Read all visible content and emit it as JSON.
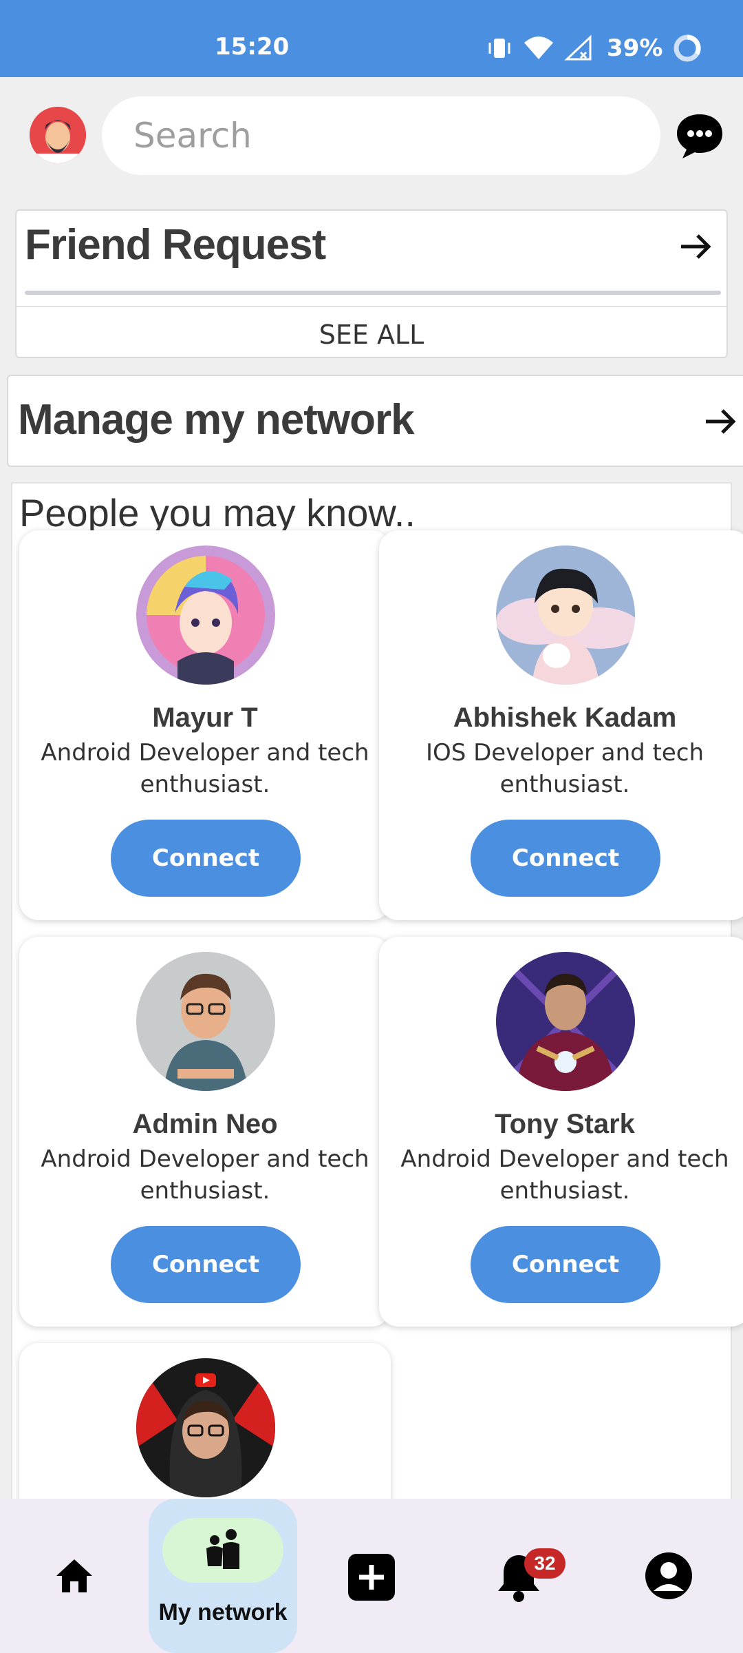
{
  "status_bar": {
    "time": "15:20",
    "battery": "39%",
    "icons": [
      "vibrate-icon",
      "wifi-icon",
      "signal-icon",
      "battery-ring-icon"
    ]
  },
  "top_bar": {
    "search_placeholder": "Search",
    "avatar_icon": "user-avatar",
    "chat_icon": "chat-bubble-icon"
  },
  "friend_request": {
    "title": "Friend Request",
    "see_all": "SEE ALL"
  },
  "manage_network": {
    "title": "Manage my network"
  },
  "people": {
    "title": "People you may know..",
    "cards": [
      {
        "name": "Mayur T",
        "bio": "Android Developer and tech enthusiast.",
        "action": "Connect"
      },
      {
        "name": "Abhishek Kadam",
        "bio": "IOS Developer and tech enthusiast.",
        "action": "Connect"
      },
      {
        "name": "Admin Neo",
        "bio": "Android Developer and tech enthusiast.",
        "action": "Connect"
      },
      {
        "name": "Tony Stark",
        "bio": "Android Developer and tech enthusiast.",
        "action": "Connect"
      }
    ]
  },
  "bottom_nav": {
    "items": [
      "home-icon",
      "my-network-icon",
      "add-icon",
      "bell-icon",
      "profile-icon"
    ],
    "active_label": "My network",
    "notification_count": "32"
  },
  "colors": {
    "accent": "#4a8fe0",
    "badge": "#c62828",
    "nav_bg": "#f0ebf4"
  }
}
